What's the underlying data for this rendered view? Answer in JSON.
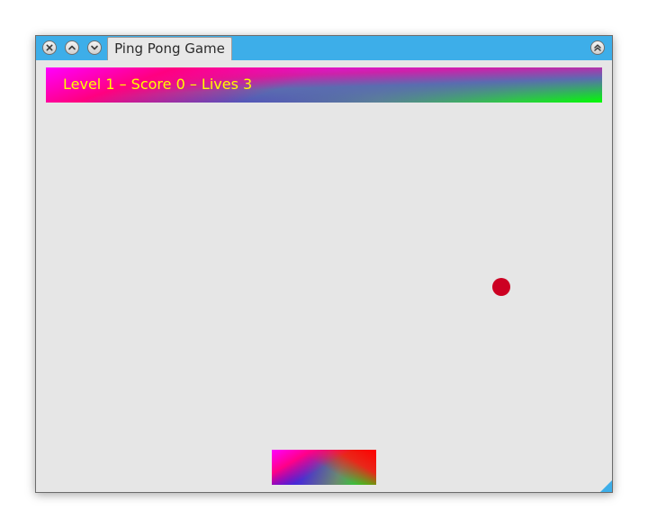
{
  "window": {
    "title": "Ping Pong Game",
    "controls": {
      "close_icon": "close-icon",
      "minimize_icon": "chevron-up-icon",
      "maximize_icon": "chevron-down-icon",
      "menu_icon": "double-chevron-up-icon"
    },
    "accent_color": "#3daee9"
  },
  "game": {
    "hud_text": "Level 1 – Score 0 – Lives 3",
    "hud_text_color": "#ffff00",
    "level": 1,
    "score": 0,
    "lives": 3,
    "ball_color": "#cc0022",
    "background_color": "#e6e6e6"
  }
}
